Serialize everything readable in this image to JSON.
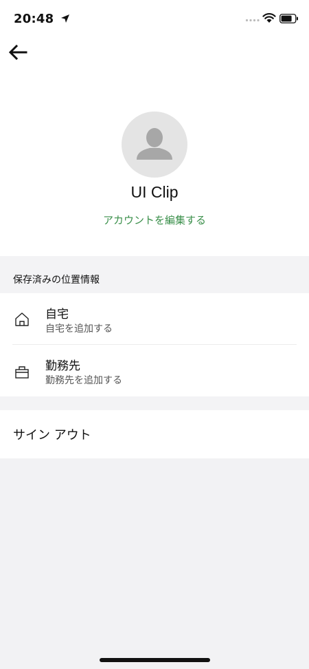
{
  "status_bar": {
    "time": "20:48"
  },
  "profile": {
    "name": "UI Clip",
    "edit_label": "アカウントを編集する"
  },
  "saved_places": {
    "section_title": "保存済みの位置情報",
    "items": [
      {
        "title": "自宅",
        "subtitle": "自宅を追加する",
        "icon": "home-icon"
      },
      {
        "title": "勤務先",
        "subtitle": "勤務先を追加する",
        "icon": "briefcase-icon"
      }
    ]
  },
  "sign_out_label": "サイン アウト",
  "colors": {
    "accent_green": "#3a8f4a",
    "background": "#f2f2f4"
  }
}
